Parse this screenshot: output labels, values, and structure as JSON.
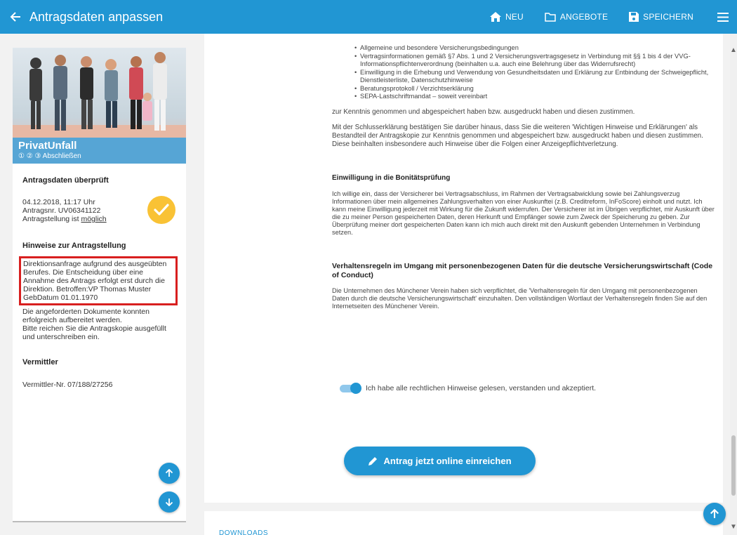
{
  "header": {
    "title": "Antragsdaten anpassen",
    "actions": {
      "new": "NEU",
      "offers": "ANGEBOTE",
      "save": "SPEICHERN"
    }
  },
  "sidebar": {
    "product_name": "PrivatUnfall",
    "product_steps": "① ② ③ Abschließen",
    "checked": {
      "heading": "Antragsdaten überprüft",
      "datetime": "04.12.2018, 11:17 Uhr",
      "application_nr": "Antragsnr. UV06341122",
      "status_prefix": "Antragstellung ist ",
      "status_value": "möglich"
    },
    "notes": {
      "heading": "Hinweise zur Antragstellung",
      "highlight": "Direktionsanfrage aufgrund des ausgeübten Berufes. Die Entscheidung über eine Annahme des Antrags erfolgt erst durch die Direktion. Betroffen:VP Thomas Muster GebDatum 01.01.1970",
      "line1": "Die angeforderten Dokumente konnten erfolgreich aufbereitet werden.",
      "line2": "Bitte reichen Sie die Antragskopie ausgefüllt und unterschreiben ein."
    },
    "broker": {
      "heading": "Vermittler",
      "number": "Vermittler-Nr. 07/188/27256"
    }
  },
  "content": {
    "bullets": [
      "Allgemeine und besondere Versicherungsbedingungen",
      "Vertragsinformationen gemäß §7 Abs. 1 und 2 Versicherungsvertragsgesetz in Verbindung mit §§ 1 bis 4 der VVG-Informationspflichtenverordnung (beinhalten u.a. auch eine Belehrung über das Widerrufsrecht)",
      "Einwilligung in die Erhebung und Verwendung von Gesundheitsdaten und Erklärung zur Entbindung der Schweigepflicht, Dienstleisterliste, Datenschutzhinweise",
      "Beratungsprotokoll / Verzichtserklärung",
      "SEPA-Lastschriftmandat – soweit vereinbart"
    ],
    "after_bullets": "zur Kenntnis genommen und abgespeichert haben bzw. ausgedruckt haben und diesen zustimmen.",
    "closing": "Mit der Schlusserklärung bestätigen Sie darüber hinaus, dass Sie die weiteren 'Wichtigen Hinweise und Erklärungen' als Bestandteil der Antragskopie zur Kenntnis genommen und abgespeichert bzw. ausgedruckt haben und diesen zustimmen. Diese beinhalten insbesondere auch Hinweise über die Folgen einer Anzeigepflichtverletzung.",
    "credit_heading": "Einwilligung in die Bonitätsprüfung",
    "credit_text": "Ich willige ein, dass der Versicherer bei Vertragsabschluss, im Rahmen der Vertragsabwicklung sowie bei Zahlungsverzug Informationen über mein allgemeines Zahlungsverhalten von einer Auskunftei (z.B. Creditreform, InFoScore) einholt und nutzt. Ich kann meine Einwilligung jederzeit mit Wirkung für die Zukunft widerrufen. Der Versicherer ist im Übrigen verpflichtet, mir Auskunft über die zu meiner Person gespeicherten Daten, deren Herkunft und Empfänger sowie zum Zweck der Speicherung zu geben. Zur Überprüfung meiner dort gespeicherten Daten kann ich mich auch direkt mit den Auskunft gebenden Unternehmen in Verbindung setzen.",
    "conduct_heading": "Verhaltensregeln im Umgang mit personenbezogenen Daten für die deutsche Versicherungswirtschaft (Code of Conduct)",
    "conduct_text": "Die Unternehmen des Münchener Verein haben sich verpflichtet, die 'Verhaltensregeln für den Umgang mit personenbezogenen Daten durch die deutsche Versicherungswirtschaft' einzuhalten. Den vollständigen Wortlaut der Verhaltensregeln finden Sie auf den Internetseiten des Münchener Verein.",
    "consent_label": "Ich habe alle rechtlichen Hinweise gelesen, verstanden und akzeptiert.",
    "submit_label": "Antrag jetzt online einreichen",
    "downloads_label": "DOWNLOADS"
  },
  "icons": [
    "back-arrow-icon",
    "home-icon",
    "folder-icon",
    "save-icon",
    "menu-icon",
    "checkmark-icon",
    "arrow-up-icon",
    "arrow-down-icon",
    "pencil-icon"
  ],
  "colors": {
    "primary": "#2196d3",
    "highlight_border": "#d81f1f",
    "check_badge": "#f9c235"
  }
}
